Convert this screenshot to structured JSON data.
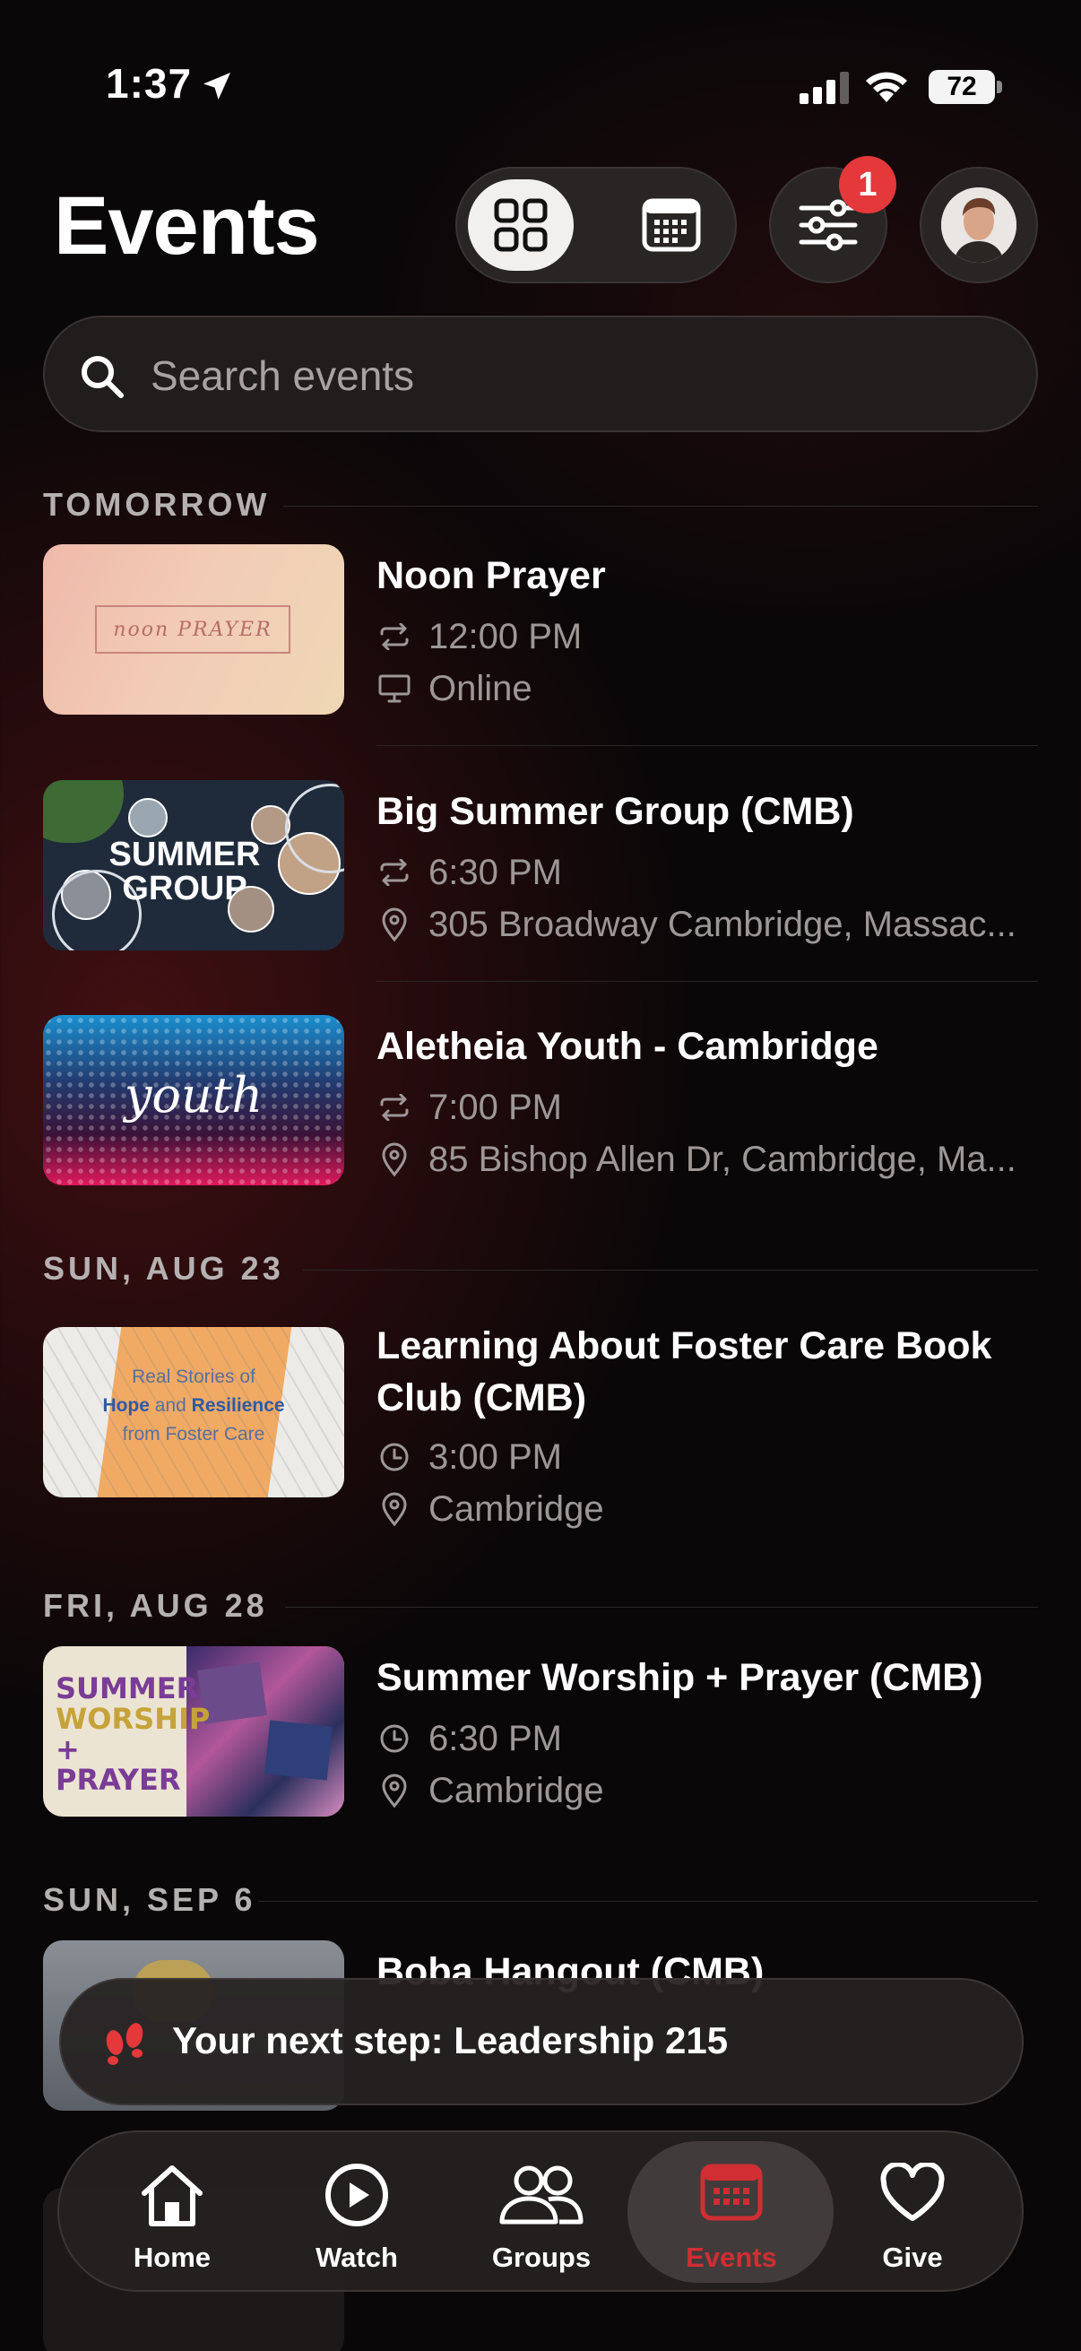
{
  "status_bar": {
    "time": "1:37",
    "battery": "72"
  },
  "header": {
    "title": "Events",
    "filter_badge": "1"
  },
  "search": {
    "placeholder": "Search events"
  },
  "sections": [
    {
      "label": "TOMORROW",
      "events": [
        {
          "title": "Noon Prayer",
          "time": "12:00 PM",
          "time_icon": "repeat-icon",
          "location": "Online",
          "location_icon": "monitor-icon",
          "thumb_text": "noon PRAYER"
        },
        {
          "title": "Big Summer Group (CMB)",
          "time": "6:30 PM",
          "time_icon": "repeat-icon",
          "location": "305 Broadway Cambridge, Massac...",
          "location_icon": "map-pin-icon",
          "thumb_text": "SUMMER GROUP"
        },
        {
          "title": "Aletheia Youth - Cambridge",
          "time": "7:00 PM",
          "time_icon": "repeat-icon",
          "location": "85 Bishop Allen Dr, Cambridge, Ma...",
          "location_icon": "map-pin-icon",
          "thumb_text": "youth"
        }
      ]
    },
    {
      "label": "SUN, AUG 23",
      "events": [
        {
          "title_line1": "Learning About Foster Care Book",
          "title_line2": "Club (CMB)",
          "time": "3:00 PM",
          "time_icon": "clock-icon",
          "location": "Cambridge",
          "location_icon": "map-pin-icon",
          "thumb_line1": "Real Stories of",
          "thumb_line2_a": "Hope",
          "thumb_line2_b": " and ",
          "thumb_line2_c": "Resilience",
          "thumb_line3": "from Foster Care"
        }
      ]
    },
    {
      "label": "FRI, AUG 28",
      "events": [
        {
          "title": "Summer Worship + Prayer (CMB)",
          "time": "6:30 PM",
          "time_icon": "clock-icon",
          "location": "Cambridge",
          "location_icon": "map-pin-icon",
          "thumb_line1": "SUMMER",
          "thumb_line2": "WORSHIP",
          "thumb_line3": "+ PRAYER"
        }
      ]
    },
    {
      "label": "SUN, SEP 6",
      "events": [
        {
          "title": "Boba Hangout (CMB)"
        }
      ]
    }
  ],
  "next_step": {
    "text": "Your next step: Leadership 215"
  },
  "tabbar": {
    "tabs": [
      {
        "label": "Home",
        "icon": "home-icon"
      },
      {
        "label": "Watch",
        "icon": "play-circle-icon"
      },
      {
        "label": "Groups",
        "icon": "people-icon"
      },
      {
        "label": "Events",
        "icon": "calendar-icon",
        "active": true
      },
      {
        "label": "Give",
        "icon": "heart-icon"
      }
    ]
  },
  "colors": {
    "accent": "#d02e33",
    "badge": "#e5383b",
    "background": "#0a0708"
  }
}
